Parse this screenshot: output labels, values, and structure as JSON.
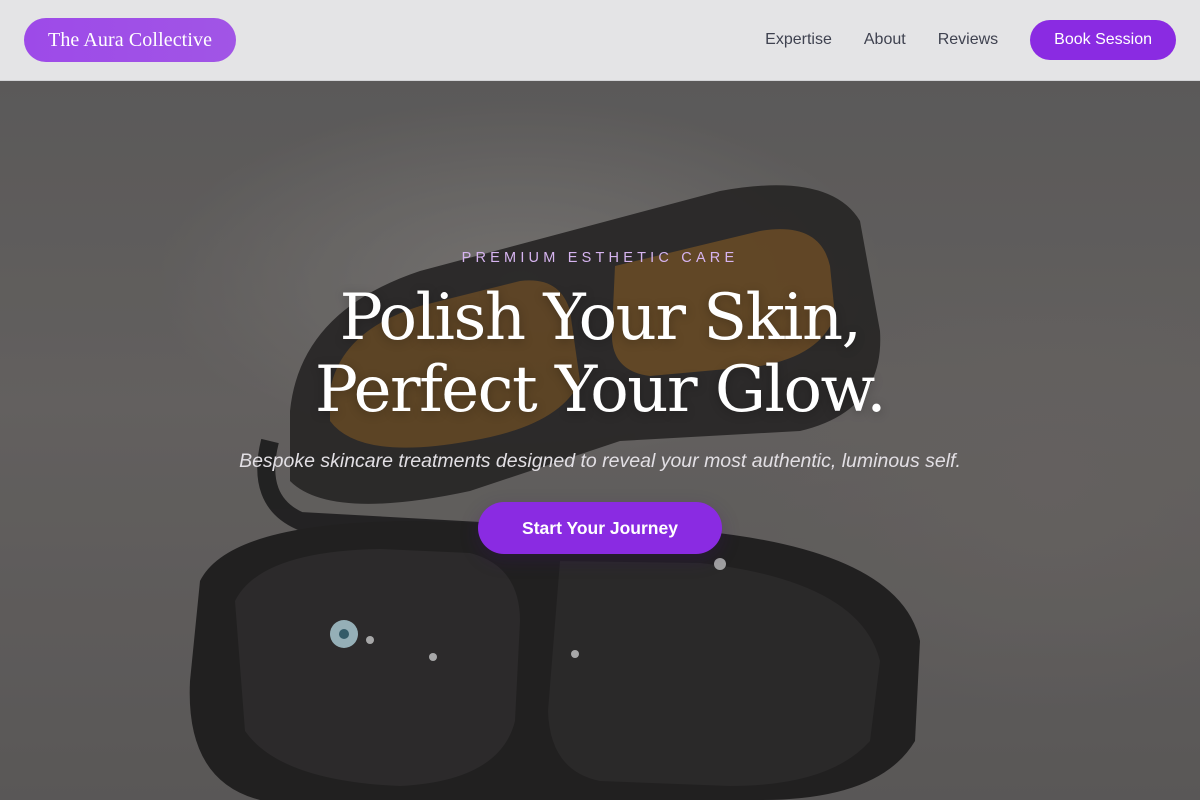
{
  "header": {
    "logo_text": "The Aura Collective",
    "nav": [
      "Expertise",
      "About",
      "Reviews"
    ],
    "cta_label": "Book Session"
  },
  "hero": {
    "eyebrow": "PREMIUM ESTHETIC CARE",
    "headline_line1": "Polish Your Skin,",
    "headline_line2": "Perfect Your Glow.",
    "subtitle": "Bespoke skincare treatments designed to reveal your most authentic, luminous self.",
    "cta_label": "Start Your Journey"
  },
  "colors": {
    "brand_purple": "#8a2be2",
    "eyebrow": "#d6b4f0",
    "header_bg": "#e4e4e6"
  },
  "background_image": "protective-eyewear-glasses-photo"
}
